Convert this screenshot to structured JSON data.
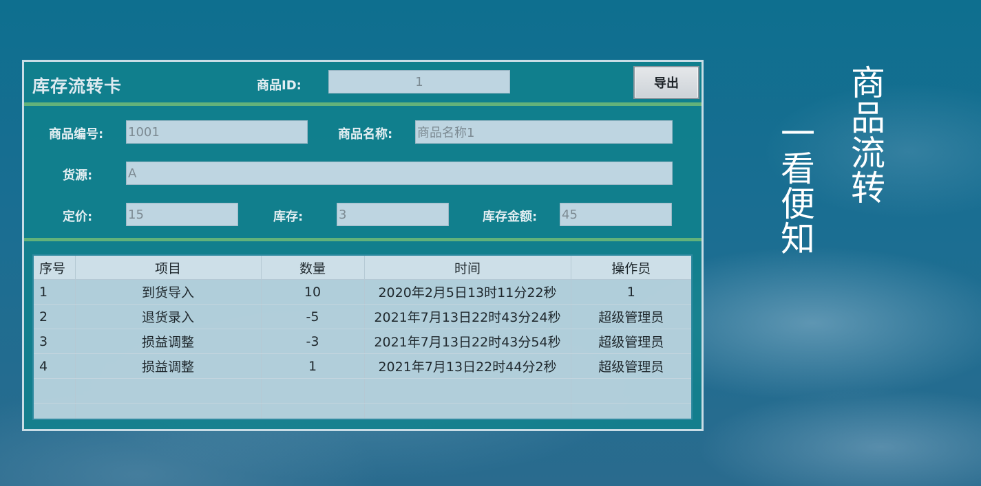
{
  "card": {
    "title": "库存流转卡",
    "product_id_label": "商品ID:",
    "product_id_value": "1",
    "export_label": "导出"
  },
  "fields": {
    "code_label": "商品编号:",
    "code_value": "1001",
    "name_label": "商品名称:",
    "name_value": "商品名称1",
    "source_label": "货源:",
    "source_value": "A",
    "price_label": "定价:",
    "price_value": "15",
    "stock_label": "库存:",
    "stock_value": "3",
    "amount_label": "库存金额:",
    "amount_value": "45"
  },
  "table": {
    "columns": [
      "序号",
      "项目",
      "数量",
      "时间",
      "操作员"
    ],
    "rows": [
      [
        "1",
        "到货导入",
        "10",
        "2020年2月5日13时11分22秒",
        "1"
      ],
      [
        "2",
        "退货录入",
        "-5",
        "2021年7月13日22时43分24秒",
        "超级管理员"
      ],
      [
        "3",
        "损益调整",
        "-3",
        "2021年7月13日22时43分54秒",
        "超级管理员"
      ],
      [
        "4",
        "损益调整",
        "1",
        "2021年7月13日22时44分2秒",
        "超级管理员"
      ]
    ]
  },
  "slogan": {
    "line1": "商品流转",
    "line2": "一看便知"
  },
  "colors": {
    "separator": "#63b27a",
    "card_bg": "#10828c",
    "field_bg": "#cddce8"
  }
}
